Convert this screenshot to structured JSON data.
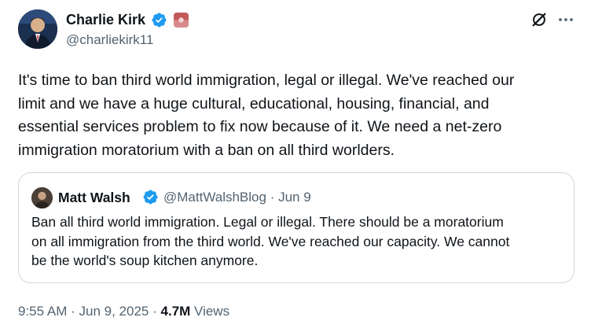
{
  "author": {
    "name": "Charlie Kirk",
    "handle": "@charliekirk11",
    "verified": true,
    "affiliation_badge": "flag-icon"
  },
  "actions": {
    "grok_icon": "grok-icon",
    "more_icon": "more-icon"
  },
  "tweet": {
    "lines": [
      "It's time to ban third world immigration, legal or illegal. We've reached our",
      "limit and we have a huge cultural, educational, housing, financial, and",
      "essential services problem to fix now because of it. We need a net-zero",
      "immigration moratorium with a ban on all third worlders."
    ]
  },
  "quote": {
    "name": "Matt Walsh",
    "handle": "@MattWalshBlog",
    "separator": "·",
    "date": "Jun 9",
    "lines": [
      "Ban all third world immigration. Legal or illegal. There should be a moratorium",
      "on all immigration from the third world. We've reached our capacity. We cannot",
      "be the world's soup kitchen anymore."
    ]
  },
  "footer": {
    "time": "9:55 AM",
    "separator1": "·",
    "date": "Jun 9, 2025",
    "separator2": "·",
    "views_count": "4.7M",
    "views_label": "Views"
  },
  "colors": {
    "verified_blue": "#1d9bf0",
    "secondary_text": "#536471",
    "primary_text": "#0f1419",
    "border": "#cfd9de"
  }
}
